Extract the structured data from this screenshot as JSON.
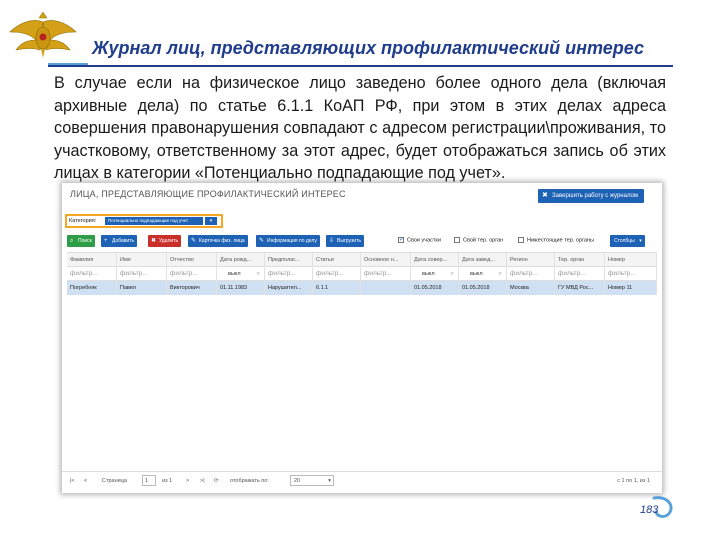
{
  "slide": {
    "title": "Журнал лиц, представляющих профилактический интерес",
    "description": "В случае если на физическое лицо заведено более одного дела (включая архивные дела) по статье 6.1.1 КоАП РФ, при этом в этих делах адреса совершения правонарушения совпадают с адресом регистрации\\проживания, то участковому, ответственному за этот адрес, будет отображаться запись об этих лицах в категории «Потенциально подпадающие под учет».",
    "page_number": "183"
  },
  "app": {
    "title": "ЛИЦА, ПРЕДСТАВЛЯЮЩИЕ ПРОФИЛАКТИЧЕСКИЙ ИНТЕРЕС",
    "finish_button": "Завершить работу с журналом",
    "category_label": "Категория:",
    "category_value": "Потенциально подпадающие под учет",
    "toolbar": {
      "find": "Поиск",
      "add": "Добавить",
      "delete": "Удалить",
      "card": "Карточка физ. лица",
      "case_info": "Информация по делу",
      "export": "Выгрузить",
      "columns": "Столбцы"
    },
    "checkboxes": {
      "own_area": "Свои участки",
      "own_org": "Свой тер. орган",
      "lower_org": "Нижестоящие тер. органы"
    },
    "table": {
      "headers": [
        "Фамилия",
        "Имя",
        "Отчество",
        "Дата рожд...",
        "Предполаг...",
        "Статьи",
        "Основное н...",
        "Дата совер...",
        "Дата завед...",
        "Регион",
        "Тер. орган",
        "Номер"
      ],
      "filter_placeholder": "фильтр...",
      "date_filter": "выкл",
      "rows": [
        [
          "Погребняк",
          "Павел",
          "Викторович",
          "01.11.1983",
          "Нарушител...",
          "6.1.1",
          "",
          "01.05.2018",
          "01.05.2018",
          "Москва",
          "ГУ МВД Рос...",
          "Номер 11"
        ]
      ]
    },
    "footer": {
      "page_label": "Страница",
      "page_value": "1",
      "of": "из 1",
      "display_label": "отображать по:",
      "page_size": "20",
      "range": "с 1 по 1, из 1"
    }
  }
}
